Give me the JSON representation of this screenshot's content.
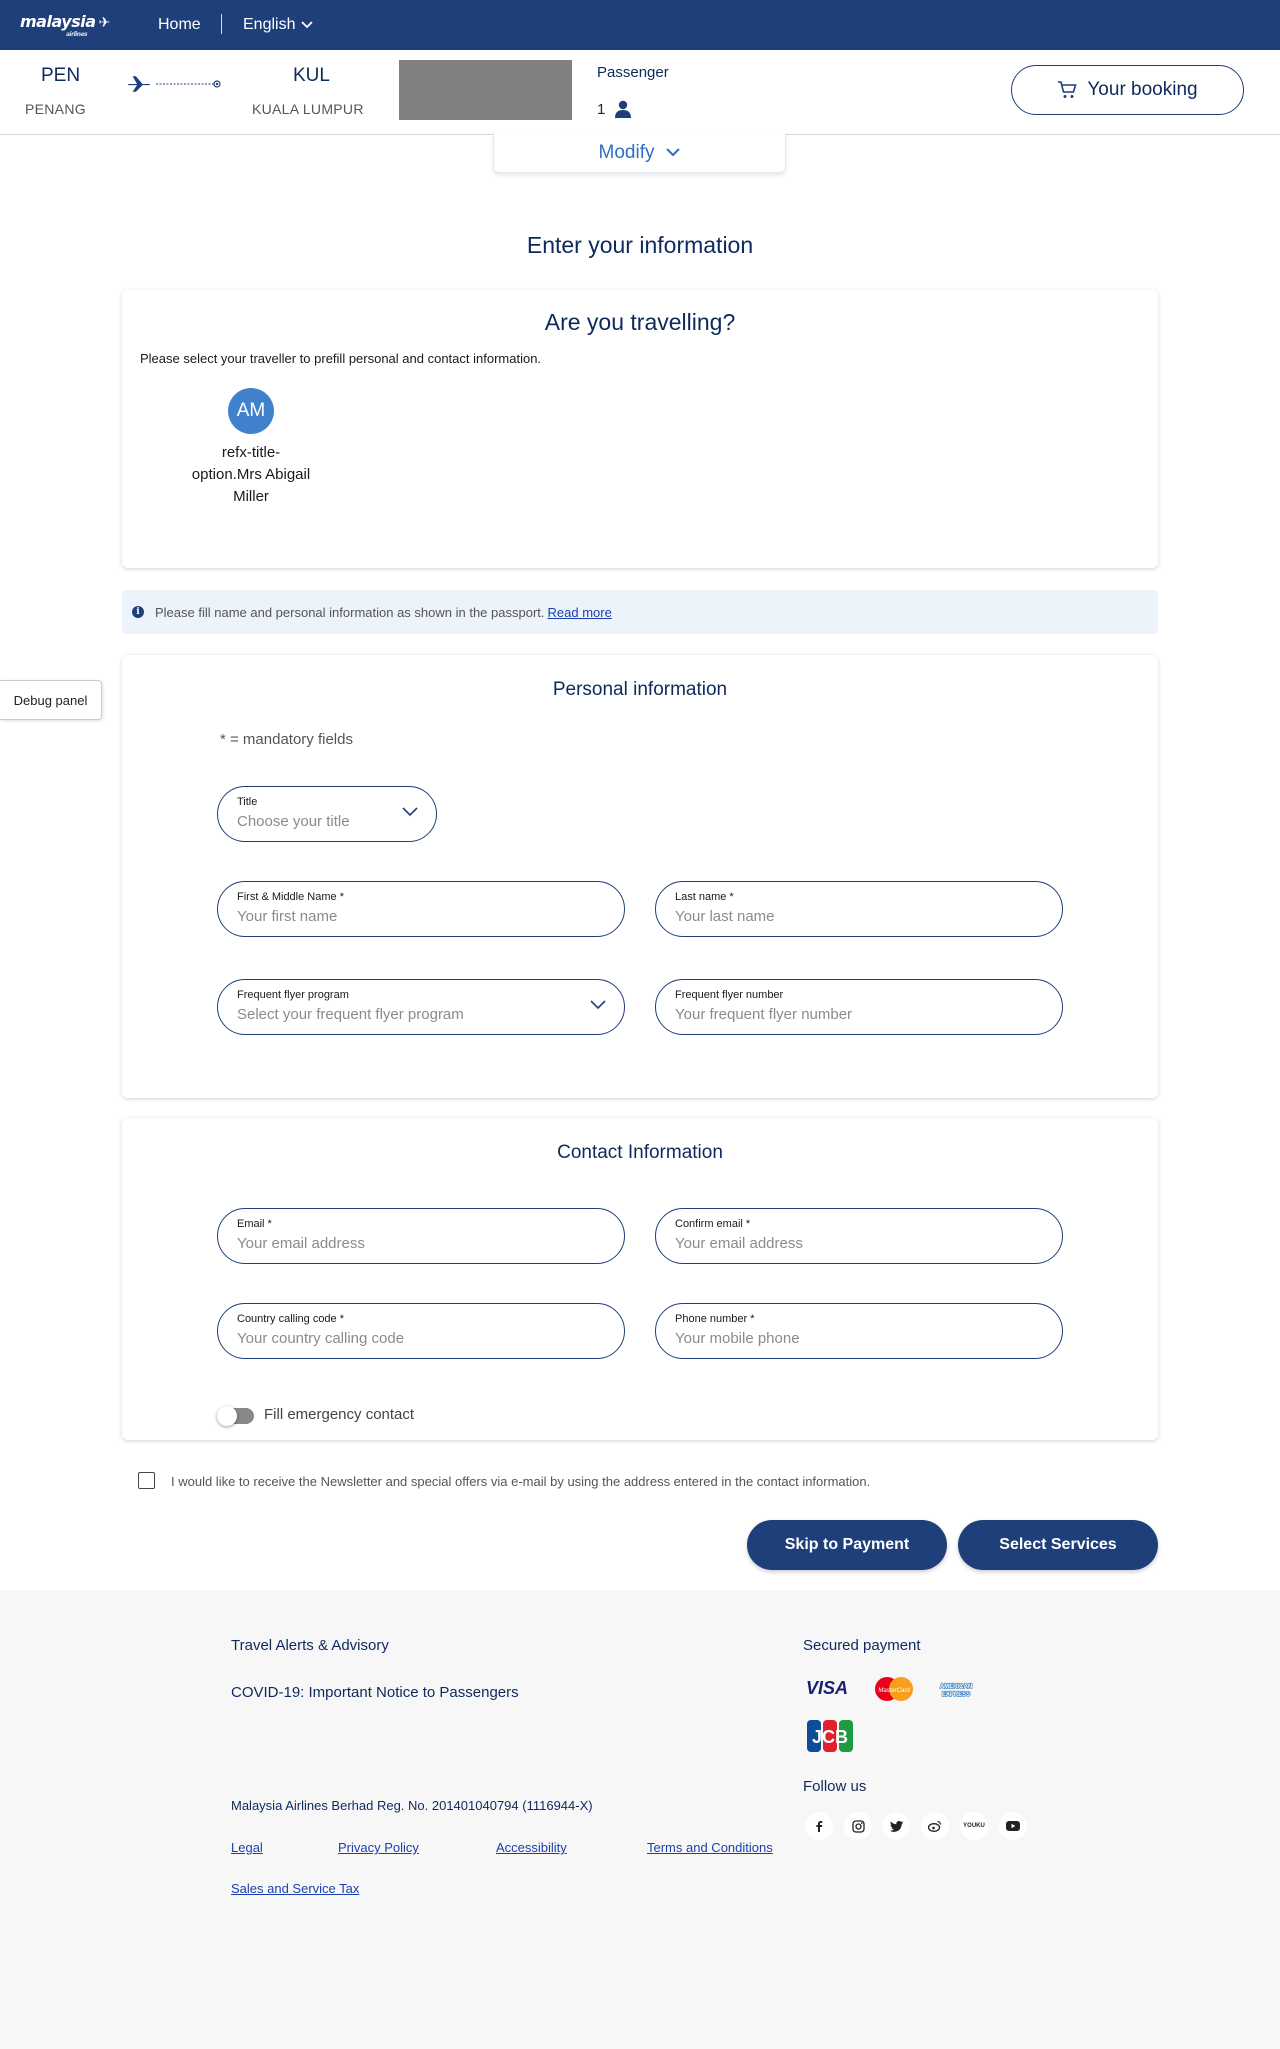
{
  "nav": {
    "brand": "malaysia",
    "brand_sub": "airlines",
    "home": "Home",
    "language": "English"
  },
  "flight": {
    "origin_code": "PEN",
    "origin_city": "PENANG",
    "dest_code": "KUL",
    "dest_city": "KUALA LUMPUR",
    "passenger_label": "Passenger",
    "passenger_count": "1",
    "booking_button": "Your booking",
    "modify": "Modify"
  },
  "page_title": "Enter your information",
  "traveller": {
    "title": "Are you travelling?",
    "hint": "Please select your traveller to prefill personal and contact information.",
    "avatar_initials": "AM",
    "name_line1": "refx-title-",
    "name_line2": "option.Mrs Abigail",
    "name_line3": "Miller"
  },
  "info_banner": {
    "text": "Please fill name and personal information as shown in the passport.",
    "link": "Read more"
  },
  "debug_panel": "Debug panel",
  "personal": {
    "title": "Personal information",
    "mandatory_note": "* = mandatory fields",
    "title_field": {
      "label": "Title",
      "placeholder": "Choose your title"
    },
    "first_name": {
      "label": "First & Middle Name *",
      "placeholder": "Your first name"
    },
    "last_name": {
      "label": "Last name *",
      "placeholder": "Your last name"
    },
    "ff_program": {
      "label": "Frequent flyer program",
      "placeholder": "Select your frequent flyer program"
    },
    "ff_number": {
      "label": "Frequent flyer number",
      "placeholder": "Your frequent flyer number"
    }
  },
  "contact": {
    "title": "Contact Information",
    "email": {
      "label": "Email *",
      "placeholder": "Your email address"
    },
    "confirm_email": {
      "label": "Confirm email *",
      "placeholder": "Your email address"
    },
    "calling_code": {
      "label": "Country calling code *",
      "placeholder": "Your country calling code"
    },
    "phone": {
      "label": "Phone number *",
      "placeholder": "Your mobile phone"
    },
    "emergency_toggle": "Fill emergency contact",
    "emergency_enabled": false
  },
  "newsletter": {
    "text": "I would like to receive the Newsletter and special offers via e-mail by using the address entered in the contact information.",
    "checked": false
  },
  "actions": {
    "skip": "Skip to Payment",
    "services": "Select Services"
  },
  "footer": {
    "travel_alerts": "Travel Alerts & Advisory",
    "covid": "COVID-19: Important Notice to Passengers",
    "registration": "Malaysia Airlines Berhad Reg. No. 201401040794 (1116944-X)",
    "legal": "Legal",
    "privacy": "Privacy Policy",
    "accessibility": "Accessibility",
    "terms": "Terms and Conditions",
    "sst": "Sales and Service Tax",
    "secured_payment": "Secured payment",
    "follow_us": "Follow us",
    "payment_logos": [
      "VISA",
      "MasterCard",
      "AMERICAN EXPRESS",
      "JCB"
    ],
    "social_icons": [
      "facebook-icon",
      "instagram-icon",
      "twitter-icon",
      "weibo-icon",
      "youku-icon",
      "youtube-icon"
    ],
    "youku_text": "YOUKU"
  },
  "colors": {
    "navy": "#1f3f7a",
    "accent_blue": "#2f6fc4",
    "avatar": "#4081cc",
    "banner": "#edf3fa"
  }
}
